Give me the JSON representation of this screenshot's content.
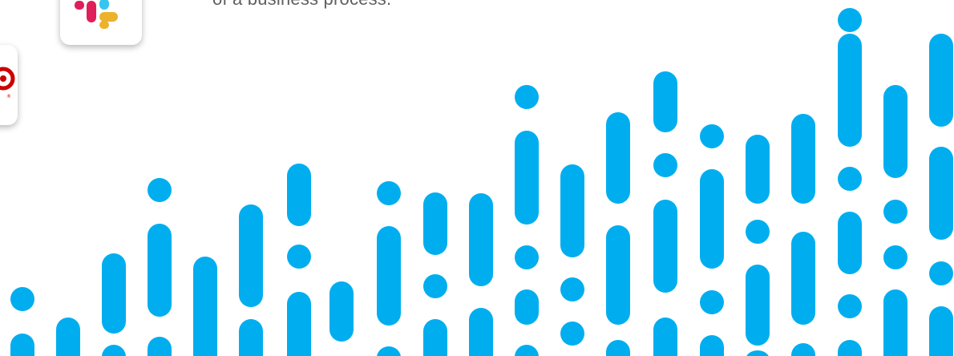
{
  "hero": {
    "tagline": "of a business process."
  },
  "logos": [
    {
      "name": "Slack",
      "icon": "slack-logo-icon"
    },
    {
      "name": "Target",
      "icon": "target-logo-icon"
    }
  ],
  "colors": {
    "pattern": "#00aeef",
    "text": "#5f5f5f",
    "slack_red": "#e01e5a",
    "slack_blue": "#36c5f0",
    "slack_yellow": "#ecb22e",
    "slack_green": "#2eb67d",
    "target_red": "#cc0000"
  },
  "decoration": {
    "name": "audio-wave-pattern"
  }
}
